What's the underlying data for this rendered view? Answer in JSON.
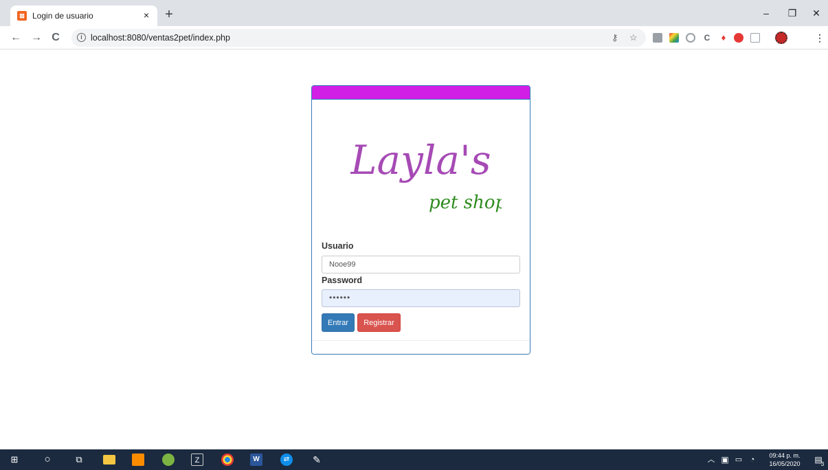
{
  "browser": {
    "tab_title": "Login de usuario",
    "tab_close": "×",
    "new_tab": "+",
    "window_controls": {
      "minimize": "–",
      "restore": "❐",
      "close": "✕"
    },
    "nav": {
      "back": "←",
      "forward": "→",
      "reload": "C"
    },
    "url": "localhost:8080/ventas2pet/index.php",
    "info_icon": "i",
    "extensions": [
      "key-icon",
      "star-icon",
      "pdf-icon",
      "color-icon",
      "screenshot-icon",
      "c-icon",
      "pin-icon",
      "download-icon",
      "cast-icon",
      "profile-icon",
      "menu-icon"
    ]
  },
  "login": {
    "header_color": "#d11fe6",
    "logo": {
      "name": "Layla's",
      "tagline": "pet shop"
    },
    "username_label": "Usuario",
    "username_value": "Nooe99",
    "password_label": "Password",
    "password_value": "••••••",
    "submit_label": "Entrar",
    "register_label": "Registrar"
  },
  "taskbar": {
    "time": "09:44 p. m.",
    "date": "16/05/2020",
    "notifications_count": "3",
    "apps": [
      "windows-start-icon",
      "cortana-icon",
      "task-view-icon",
      "file-explorer-icon",
      "xampp-icon",
      "app-icon",
      "filezilla-icon",
      "chrome-icon",
      "word-icon",
      "teamviewer-icon",
      "paint-icon"
    ]
  }
}
